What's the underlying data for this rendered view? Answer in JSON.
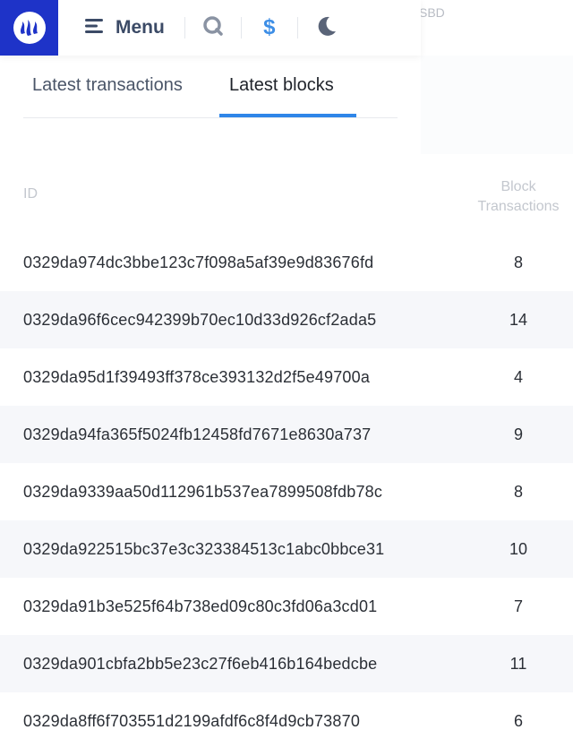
{
  "header": {
    "menu_label": "Menu",
    "currency_symbol": "$",
    "background_partial_text": "SBD",
    "logo_color": "#1e33c8",
    "accent_color": "#2f86e8"
  },
  "tabs": [
    {
      "label": "Latest transactions",
      "active": false
    },
    {
      "label": "Latest blocks",
      "active": true
    }
  ],
  "table": {
    "col_id": "ID",
    "col_block_line1": "Block",
    "col_block_line2": "Transactions",
    "rows": [
      {
        "id": "0329da974dc3bbe123c7f098a5af39e9d83676fd",
        "count": "8"
      },
      {
        "id": "0329da96f6cec942399b70ec10d33d926cf2ada5",
        "count": "14"
      },
      {
        "id": "0329da95d1f39493ff378ce393132d2f5e49700a",
        "count": "4"
      },
      {
        "id": "0329da94fa365f5024fb12458fd7671e8630a737",
        "count": "9"
      },
      {
        "id": "0329da9339aa50d112961b537ea7899508fdb78c",
        "count": "8"
      },
      {
        "id": "0329da922515bc37e3c323384513c1abc0bbce31",
        "count": "10"
      },
      {
        "id": "0329da91b3e525f64b738ed09c80c3fd06a3cd01",
        "count": "7"
      },
      {
        "id": "0329da901cbfa2bb5e23c27f6eb416b164bedcbe",
        "count": "11"
      },
      {
        "id": "0329da8ff6f703551d2199afdf6c8f4d9cb73870",
        "count": "6"
      }
    ]
  }
}
